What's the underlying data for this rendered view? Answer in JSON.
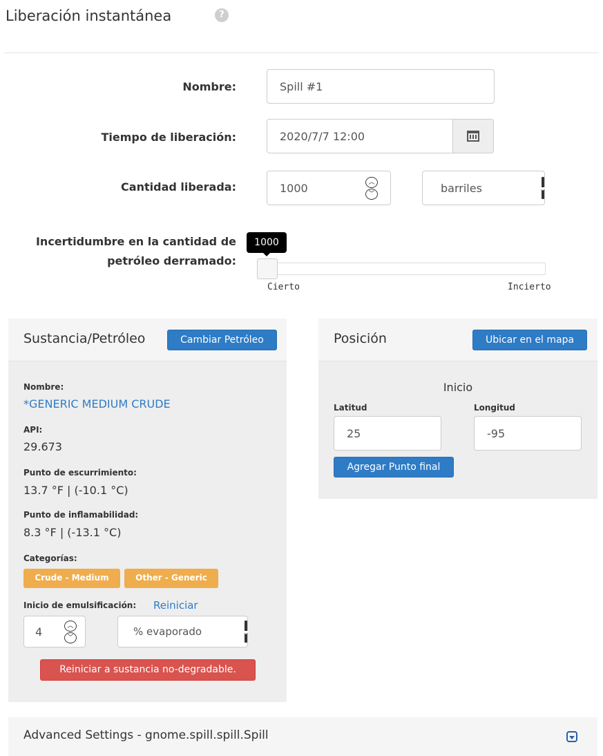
{
  "header": {
    "title": "Liberación instantánea",
    "help_icon": "question-circle-icon"
  },
  "form": {
    "name_label": "Nombre:",
    "name_value": "Spill #1",
    "time_label": "Tiempo de liberación:",
    "time_value": "2020/7/7 12:00",
    "calendar_icon": "calendar-icon",
    "amount_label": "Cantidad liberada:",
    "amount_value": "1000",
    "units_value": "barriles",
    "uncertainty_label_line1": "Incertidumbre en la cantidad de",
    "uncertainty_label_line2": "petróleo derramado:",
    "slider_tooltip": "1000",
    "slider_min_label": "Cierto",
    "slider_max_label": "Incierto",
    "slider_position": 0
  },
  "substance": {
    "title": "Sustancia/Petróleo",
    "change_button": "Cambiar Petróleo",
    "name_label": "Nombre:",
    "name_value": "*GENERIC MEDIUM CRUDE",
    "api_label": "API:",
    "api_value": "29.673",
    "pour_label": "Punto de escurrimiento:",
    "pour_value": "13.7 °F | (-10.1 °C)",
    "flash_label": "Punto de inflamabilidad:",
    "flash_value": "8.3 °F | (-13.1 °C)",
    "categories_label": "Categorías:",
    "categories": [
      "Crude - Medium",
      "Other - Generic"
    ],
    "emulsion_label": "Inicio de emulsificación:",
    "emulsion_reset": "Reiniciar",
    "emulsion_value": "4",
    "emulsion_unit": "% evaporado",
    "reset_button": "Reiniciar a sustancia no-degradable."
  },
  "position": {
    "title": "Posición",
    "map_button": "Ubicar en el mapa",
    "start_label": "Inicio",
    "lat_label": "Latitud",
    "lat_value": "25",
    "lon_label": "Longitud",
    "lon_value": "-95",
    "add_end_button": "Agregar Punto final"
  },
  "advanced": {
    "title": "Advanced Settings - gnome.spill.spill.Spill",
    "toggle_icon": "chevron-down-square-icon"
  },
  "colors": {
    "primary": "#2e7bc6",
    "warning": "#efad4d",
    "danger": "#d9534f",
    "panel_bg": "#eeeeee"
  }
}
